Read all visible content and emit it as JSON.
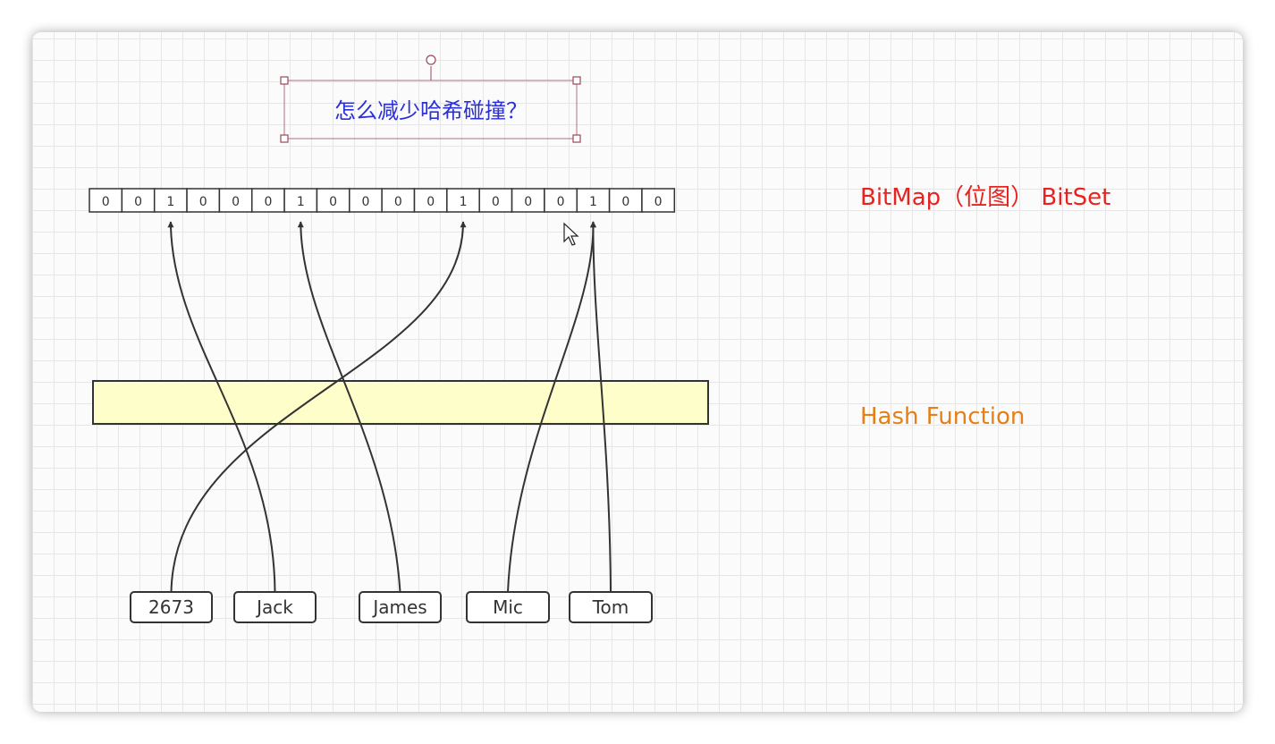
{
  "title": "怎么减少哈希碰撞？",
  "bitmap": {
    "bits": [
      "0",
      "0",
      "1",
      "0",
      "0",
      "0",
      "1",
      "0",
      "0",
      "0",
      "0",
      "1",
      "0",
      "0",
      "0",
      "1",
      "0",
      "0"
    ],
    "label": "BitMap（位图） BitSet"
  },
  "hash_function": {
    "label": "Hash Function"
  },
  "nodes": [
    {
      "label": "2673",
      "target_bit": 11
    },
    {
      "label": "Jack",
      "target_bit": 2
    },
    {
      "label": "James",
      "target_bit": 6
    },
    {
      "label": "Mic",
      "target_bit": 15
    },
    {
      "label": "Tom",
      "target_bit": 15
    }
  ],
  "colors": {
    "bitmap_label": "#e8231f",
    "hash_label": "#e57f16",
    "title": "#2a2fd6",
    "hash_fill": "#fefecb"
  }
}
